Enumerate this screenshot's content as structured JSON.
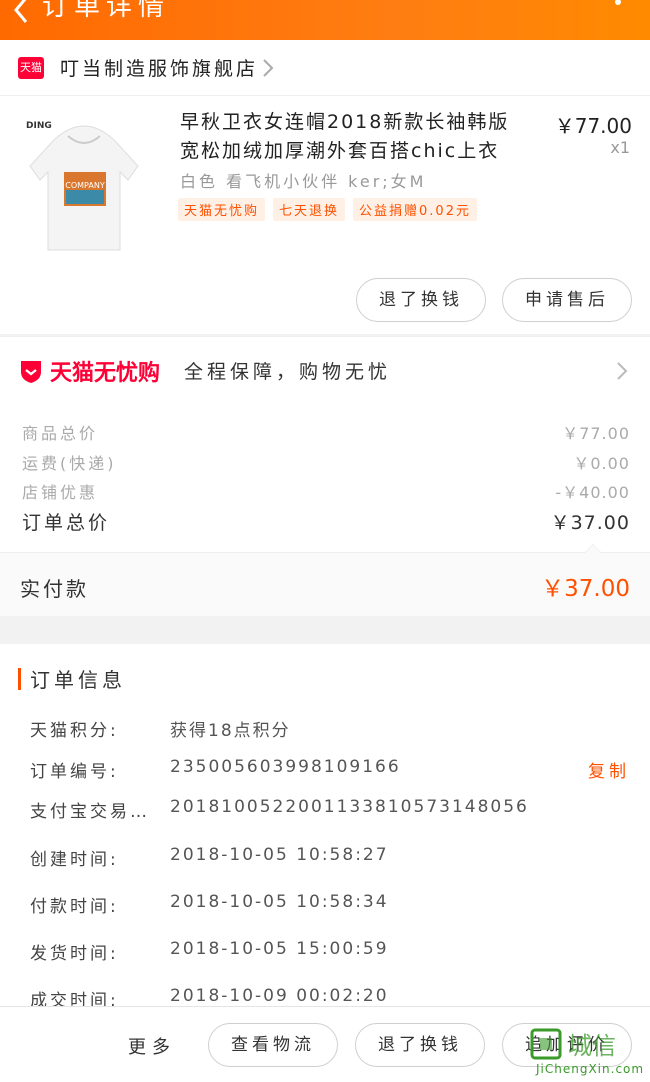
{
  "header": {
    "title": "订单详情",
    "colors": {
      "from": "#ff6a00",
      "to": "#ff8a00"
    }
  },
  "store": {
    "badge": "天猫",
    "name": "叮当制造服饰旗舰店"
  },
  "product": {
    "name": "早秋卫衣女连帽2018新款长袖韩版宽松加绒加厚潮外套百搭chic上衣",
    "price": "￥77.00",
    "qty": "x1",
    "sku": "白色  看飞机小伙伴  ker;女M",
    "tags": [
      "天猫无忧购",
      "七天退换",
      "公益捐赠0.02元"
    ],
    "thumb_text": "COMPANY",
    "buttons": {
      "refund": "退了换钱",
      "after_sale": "申请售后"
    }
  },
  "assurance": {
    "brand": "天猫无忧购",
    "slogan": "全程保障，购物无忧"
  },
  "fees": {
    "items": [
      {
        "label": "商品总价",
        "value": "￥77.00"
      },
      {
        "label": "运费(快递)",
        "value": "￥0.00"
      },
      {
        "label": "店铺优惠",
        "value": "-￥40.00"
      }
    ],
    "total_label": "订单总价",
    "total_value": "￥37.00"
  },
  "paid": {
    "label": "实付款",
    "value": "￥37.00"
  },
  "order_info": {
    "title": "订单信息",
    "rows": [
      {
        "label": "天猫积分:",
        "value": "获得18点积分"
      },
      {
        "label": "订单编号:",
        "value": "235005603998109166",
        "action": "复制"
      },
      {
        "label": "支付宝交易…",
        "value": "2018100522001133810573148056"
      },
      {
        "label": "创建时间:",
        "value": "2018-10-05 10:58:27"
      },
      {
        "label": "付款时间:",
        "value": "2018-10-05 10:58:34"
      },
      {
        "label": "发货时间:",
        "value": "2018-10-05 15:00:59"
      },
      {
        "label": "成交时间:",
        "value": "2018-10-09 00:02:20"
      }
    ]
  },
  "bottom": {
    "more": "更多",
    "logistics": "查看物流",
    "refund": "退了换钱",
    "review": "追加评价"
  },
  "watermark": {
    "text": "JiChengXin.com"
  }
}
